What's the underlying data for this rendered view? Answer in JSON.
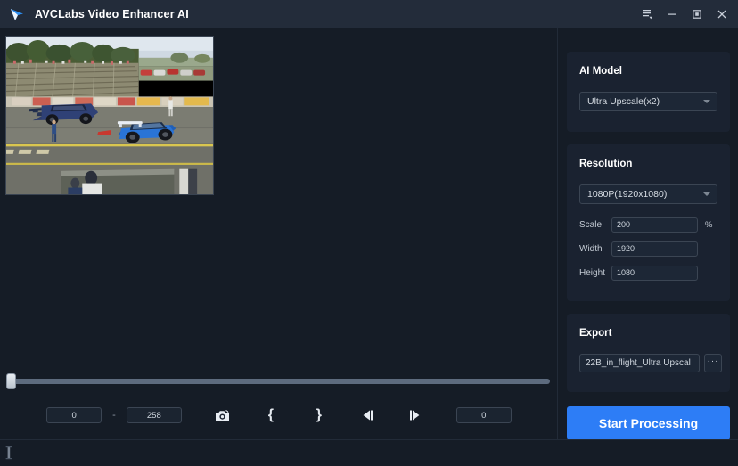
{
  "window": {
    "title": "AVCLabs Video Enhancer AI",
    "logo_icon": "play-triangle-logo",
    "controls": [
      {
        "name": "menu",
        "icon": "hamburger-menu-icon",
        "label": ""
      },
      {
        "name": "minimize",
        "icon": "minimize-icon",
        "label": ""
      },
      {
        "name": "maximize",
        "icon": "maximize-icon",
        "label": ""
      },
      {
        "name": "close",
        "icon": "close-icon",
        "label": ""
      }
    ]
  },
  "preview": {
    "alt": "drag racing video frame with two blue cars on a track"
  },
  "timeline": {
    "position_percent": 0
  },
  "transport": {
    "start_frame": "0",
    "separator": "-",
    "end_frame": "258",
    "current_frame": "0",
    "buttons": [
      {
        "name": "snapshot",
        "icon": "camera-icon"
      },
      {
        "name": "mark-in",
        "icon": "brace-left-icon",
        "glyph": "{"
      },
      {
        "name": "mark-out",
        "icon": "brace-right-icon",
        "glyph": "}"
      },
      {
        "name": "prev-frame",
        "icon": "step-backward-icon"
      },
      {
        "name": "next-frame",
        "icon": "step-forward-icon"
      }
    ]
  },
  "sidebar": {
    "ai_model": {
      "title": "AI Model",
      "selected": "Ultra Upscale(x2)"
    },
    "resolution": {
      "title": "Resolution",
      "selected": "1080P(1920x1080)",
      "fields": [
        {
          "label": "Scale",
          "value": "200",
          "suffix": "%"
        },
        {
          "label": "Width",
          "value": "1920",
          "suffix": ""
        },
        {
          "label": "Height",
          "value": "1080",
          "suffix": ""
        }
      ]
    },
    "export": {
      "title": "Export",
      "filename": "22B_in_flight_Ultra Upscal",
      "browse_label": "···"
    },
    "start_button": "Start Processing"
  },
  "statusbar": {
    "icon": "info-cursor-icon",
    "text": ""
  },
  "colors": {
    "accent": "#2d7df6",
    "titlebar": "#232c3a",
    "background": "#151c26",
    "card": "#1a2230",
    "input": "#1d2736",
    "border": "#3b4553"
  }
}
